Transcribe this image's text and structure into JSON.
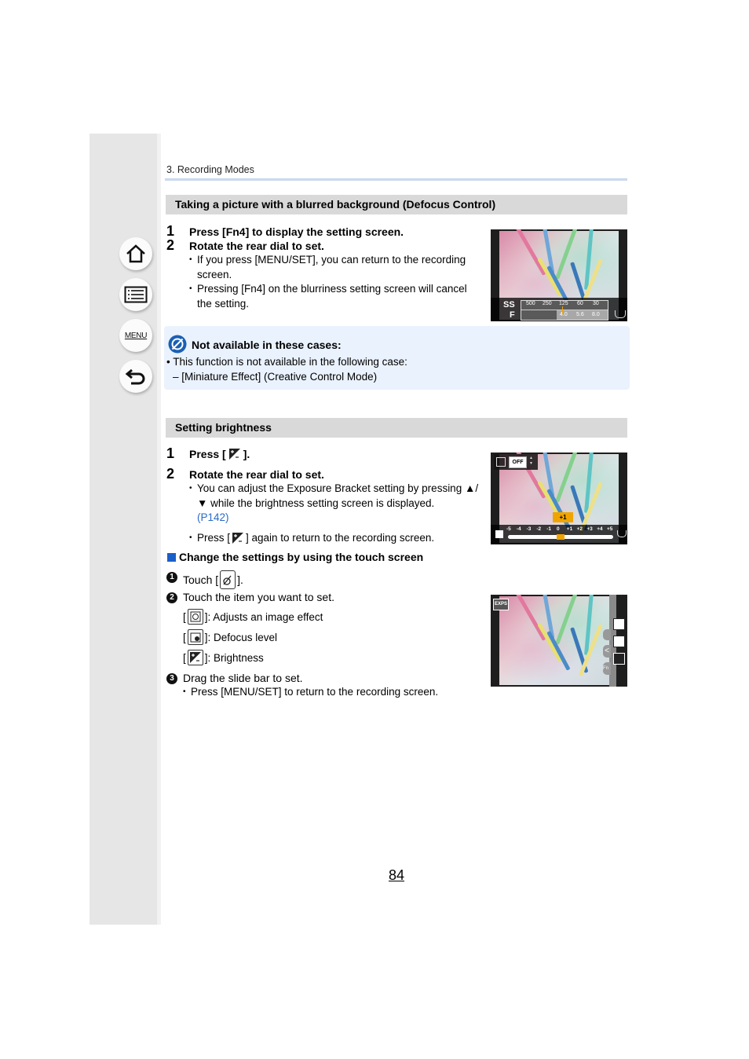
{
  "sidebar": {
    "buttons": [
      {
        "name": "home",
        "icon": "home-icon"
      },
      {
        "name": "contents",
        "icon": "list-icon"
      },
      {
        "name": "menu",
        "label": "MENU"
      },
      {
        "name": "back",
        "icon": "back-arrow-icon"
      }
    ]
  },
  "breadcrumb": "3. Recording Modes",
  "section1": {
    "title": "Taking a picture with a blurred background (Defocus Control)",
    "steps": [
      {
        "num": "1",
        "text": "Press [Fn4] to display the setting screen."
      },
      {
        "num": "2",
        "text": "Rotate the rear dial to set."
      }
    ],
    "bullets": [
      "If you press [MENU/SET], you can return to the recording screen.",
      "Pressing [Fn4] on the blurriness setting screen will cancel the setting."
    ],
    "screen": {
      "ss_label": "SS",
      "f_label": "F",
      "ss_values": [
        "500",
        "250",
        "125",
        "60",
        "30"
      ],
      "f_values": [
        "4.0",
        "5.6",
        "8.0"
      ]
    }
  },
  "note": {
    "title": "Not available in these cases:",
    "line1": "• This function is not available in the following case:",
    "line2": "– [Miniature Effect] (Creative Control Mode)"
  },
  "section2": {
    "title": "Setting brightness",
    "step1_prefix": "Press [",
    "step1_suffix": "].",
    "step2": "Rotate the rear dial to set.",
    "bullet1": "You can adjust the Exposure Bracket setting by pressing ▲/▼ while the brightness setting screen is displayed.",
    "bullet1_link": "(P142)",
    "bullet2_prefix": "Press [",
    "bullet2_suffix": "] again to return to the recording screen.",
    "screen": {
      "bracket_value": "OFF",
      "current_value": "+1",
      "scale": [
        "-5",
        "-4",
        "-3",
        "-2",
        "-1",
        "0",
        "+1",
        "+2",
        "+3",
        "+4",
        "+5"
      ]
    },
    "touch_heading": "Change the settings by using the touch screen",
    "touch_steps": [
      {
        "num": "1",
        "prefix": "Touch [",
        "suffix": "]."
      },
      {
        "num": "2",
        "text": "Touch the item you want to set."
      },
      {
        "num": "3",
        "text": "Drag the slide bar to set."
      }
    ],
    "items": [
      {
        "icon": "image-effect-icon",
        "label": "]: Adjusts an image effect"
      },
      {
        "icon": "defocus-icon",
        "label": "]: Defocus level"
      },
      {
        "icon": "brightness-icon",
        "label": "]: Brightness"
      }
    ],
    "final_bullet": "Press [MENU/SET] to return to the recording screen.",
    "touch_screen": {
      "mode_badge": "EXPS",
      "fn_tab": "Fn"
    }
  },
  "page_number": "84"
}
